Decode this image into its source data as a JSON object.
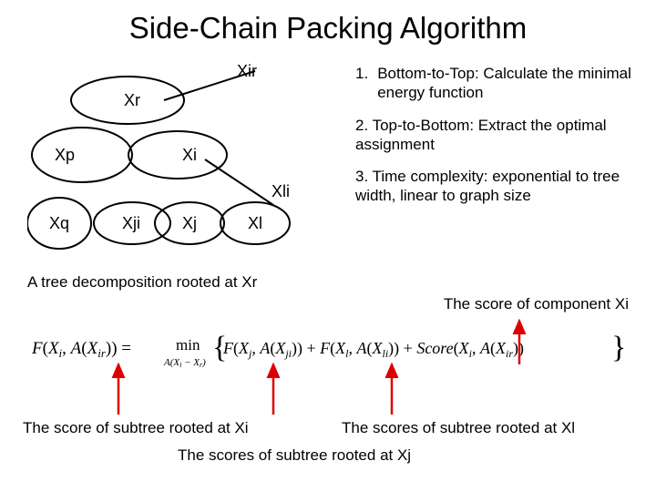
{
  "title": "Side-Chain Packing Algorithm",
  "tree": {
    "xr": "Xr",
    "xp": "Xp",
    "xi": "Xi",
    "xq": "Xq",
    "xji": "Xji",
    "xj": "Xj",
    "xl": "Xl",
    "xir": "Xir",
    "xli": "Xli"
  },
  "steps": {
    "s1_num": "1.",
    "s1": "Bottom-to-Top: Calculate the minimal energy function",
    "s2": "2. Top-to-Bottom: Extract the optimal assignment",
    "s3": "3. Time complexity: exponential to tree width, linear to graph size"
  },
  "caption_tree": "A tree decomposition rooted at Xr",
  "comp_xi": "The score of component Xi",
  "label_xi": "The score of subtree rooted at Xi",
  "label_xl": "The scores of subtree rooted at Xl",
  "label_xj": "The scores of subtree rooted at Xj",
  "formula": {
    "lhs_f": "F",
    "lhs_arg": "(X",
    "i": "i",
    "comma_a": ", A(X",
    "ir": "ir",
    "close2": "))",
    "eq": "=",
    "min": "min",
    "minsub": "A(X",
    "minsub_i": "i",
    "minsub_close": " − X",
    "minsub_r": "r",
    "minsub_end": ")",
    "f2": "F(X",
    "j": "j",
    "a2": ", A(X",
    "ji": "ji",
    "plus1": ")) + F(X",
    "l": "l",
    "a3": ", A(X",
    "li": "li",
    "plus2": ")) + Score(X",
    "score_i": "i",
    "a4": ", A(X",
    "score_ir": "ir",
    "end": "))"
  }
}
